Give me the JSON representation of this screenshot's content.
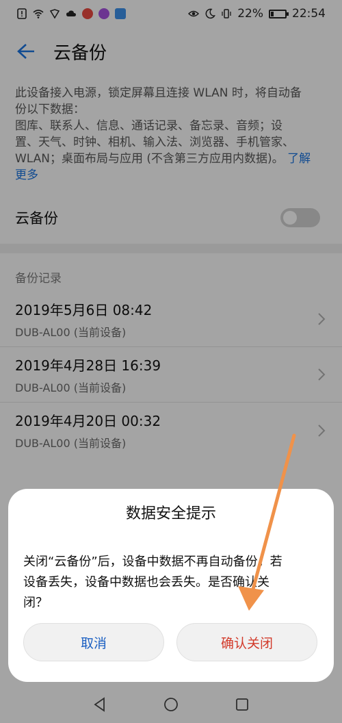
{
  "status": {
    "battery": "22%",
    "time": "22:54",
    "battery_level": 0.22
  },
  "appbar": {
    "title": "云备份"
  },
  "description": {
    "lines": [
      "此设备接入电源，锁定屏幕且连接 WLAN 时，将自动备",
      "份以下数据：",
      "图库、联系人、信息、通话记录、备忘录、音频；设",
      "置、天气、时钟、相机、输入法、浏览器、手机管家、"
    ],
    "last_line": "WLAN；桌面布局与应用 (不含第三方应用内数据)。",
    "link_part1": "了解",
    "link_part2": "更多"
  },
  "toggle": {
    "label": "云备份",
    "on": false
  },
  "records_header": "备份记录",
  "records": [
    {
      "date": "2019年5月6日 08:42",
      "device": "DUB-AL00 (当前设备)"
    },
    {
      "date": "2019年4月28日 16:39",
      "device": "DUB-AL00 (当前设备)"
    },
    {
      "date": "2019年4月20日 00:32",
      "device": "DUB-AL00 (当前设备)"
    }
  ],
  "dialog": {
    "title": "数据安全提示",
    "message_line1": "关闭“云备份”后，设备中数据不再自动备份。若",
    "message_line2": "设备丢失，设备中数据也会丢失。是否确认关",
    "message_line3": "闭？",
    "cancel": "取消",
    "confirm": "确认关闭"
  },
  "colors": {
    "link": "#1a6fd6",
    "cancel": "#1a5fc2",
    "confirm": "#d23a2a",
    "annotation_arrow": "#f0924a"
  }
}
